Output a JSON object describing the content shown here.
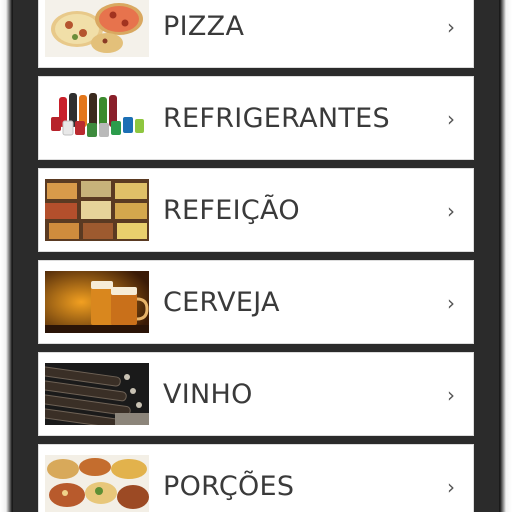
{
  "menu": {
    "items": [
      {
        "label": "PIZZA",
        "icon": "pizza-photo"
      },
      {
        "label": "REFRIGERANTES",
        "icon": "soft-drinks-photo"
      },
      {
        "label": "REFEIÇÃO",
        "icon": "meal-buffet-photo"
      },
      {
        "label": "CERVEJA",
        "icon": "beer-photo"
      },
      {
        "label": "VINHO",
        "icon": "wine-bottles-photo"
      },
      {
        "label": "PORÇÕES",
        "icon": "portions-photo"
      }
    ],
    "chevron": "›"
  }
}
